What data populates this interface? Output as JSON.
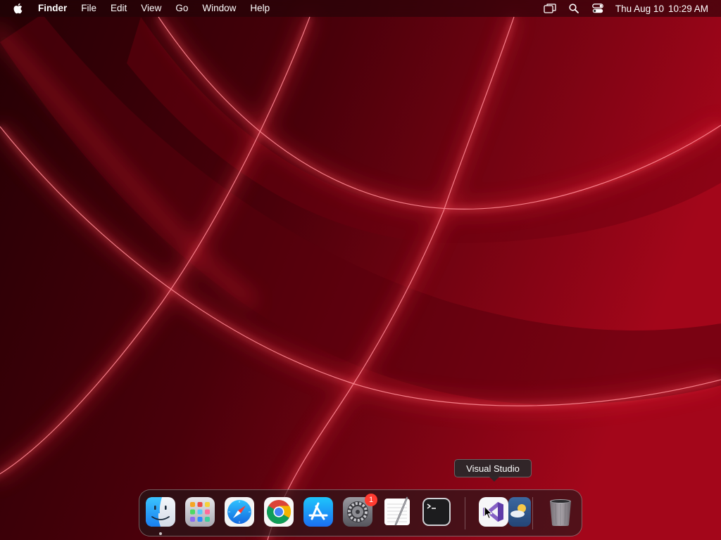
{
  "menubar": {
    "apple_icon": "apple-logo-icon",
    "app_name": "Finder",
    "items": [
      "File",
      "Edit",
      "View",
      "Go",
      "Window",
      "Help"
    ],
    "status_icons": [
      "screen-mirroring-icon",
      "spotlight-search-icon",
      "control-center-icon"
    ],
    "clock": {
      "date": "Thu Aug 10",
      "time": "10:29 AM"
    }
  },
  "tooltip": {
    "text": "Visual Studio"
  },
  "dock": {
    "apps": [
      {
        "name": "Finder",
        "icon": "finder-icon",
        "running": true
      },
      {
        "name": "Launchpad",
        "icon": "launchpad-icon",
        "running": false
      },
      {
        "name": "Safari",
        "icon": "safari-icon",
        "running": false
      },
      {
        "name": "Google Chrome",
        "icon": "chrome-icon",
        "running": false
      },
      {
        "name": "App Store",
        "icon": "app-store-icon",
        "running": false
      },
      {
        "name": "System Preferences",
        "icon": "system-preferences-icon",
        "running": false,
        "badge": "1"
      },
      {
        "name": "TextEdit",
        "icon": "textedit-icon",
        "running": false
      },
      {
        "name": "Terminal",
        "icon": "terminal-icon",
        "running": false
      },
      {
        "name": "Visual Studio",
        "icon": "visual-studio-icon",
        "running": false,
        "hovered": true
      },
      {
        "name": "Weather",
        "icon": "weather-icon",
        "running": false
      },
      {
        "name": "Trash",
        "icon": "trash-icon",
        "running": false
      }
    ]
  },
  "colors": {
    "wallpaper_dark": "#2a0006",
    "wallpaper_mid": "#8a0010",
    "wallpaper_glow": "#ff3a4a",
    "badge": "#ff3b30"
  }
}
